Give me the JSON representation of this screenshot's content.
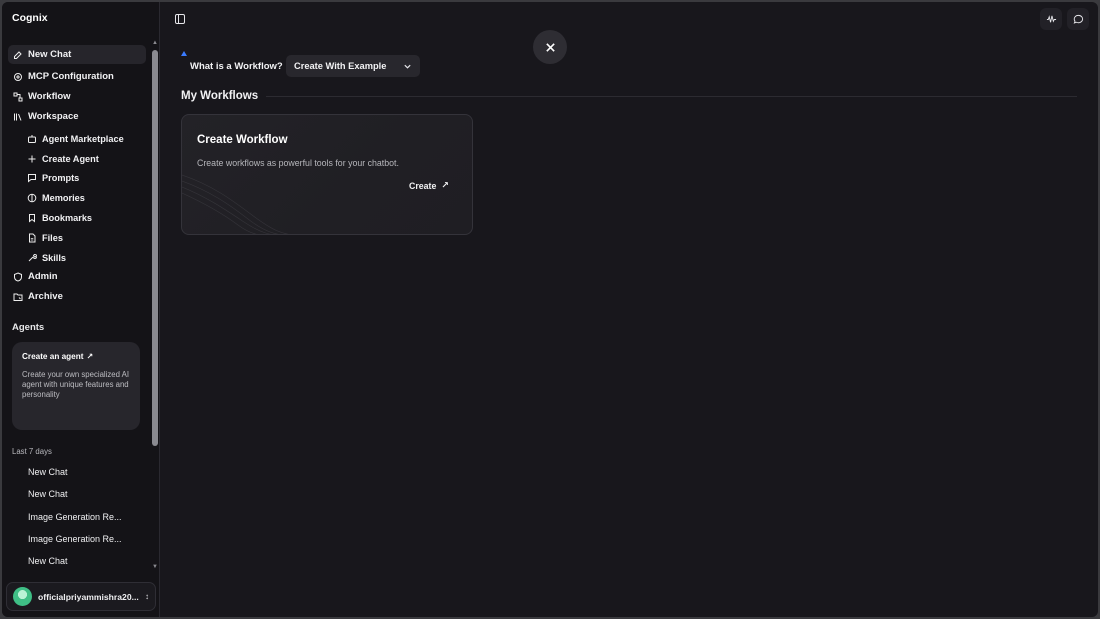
{
  "app": {
    "title": "Cognix"
  },
  "sidebar": {
    "items": [
      {
        "label": "New Chat",
        "icon": "edit-icon",
        "active": true
      },
      {
        "label": "MCP Configuration",
        "icon": "mcp-icon"
      },
      {
        "label": "Workflow",
        "icon": "workflow-icon"
      },
      {
        "label": "Workspace",
        "icon": "library-icon"
      }
    ],
    "workspace_items": [
      {
        "label": "Agent Marketplace",
        "icon": "bot-icon"
      },
      {
        "label": "Create Agent",
        "icon": "plus-icon"
      },
      {
        "label": "Prompts",
        "icon": "message-square-icon"
      },
      {
        "label": "Memories",
        "icon": "memory-icon"
      },
      {
        "label": "Bookmarks",
        "icon": "bookmark-icon"
      },
      {
        "label": "Files",
        "icon": "file-icon"
      },
      {
        "label": "Skills",
        "icon": "wrench-icon"
      }
    ],
    "bottom_items": [
      {
        "label": "Admin",
        "icon": "shield-icon"
      },
      {
        "label": "Archive",
        "icon": "archive-folder-icon"
      }
    ],
    "agents_section": "Agents",
    "agent_card": {
      "title": "Create an agent",
      "description": "Create your own specialized AI agent with unique features and personality"
    },
    "recent_label": "Last 7 days",
    "recent_chats": [
      "New Chat",
      "New Chat",
      "Image Generation Re...",
      "Image Generation Re...",
      "New Chat"
    ],
    "user": {
      "name": "officialpriyammishra20..."
    }
  },
  "main": {
    "what_is_workflow": "What is a Workflow?",
    "example_select": "Create With Example",
    "section_title": "My Workflows",
    "card": {
      "title": "Create Workflow",
      "description": "Create workflows as powerful tools for your chatbot.",
      "action": "Create"
    }
  },
  "colors": {
    "accent": "#3a7bff",
    "background": "#18171c",
    "sidebar": "#141317"
  }
}
